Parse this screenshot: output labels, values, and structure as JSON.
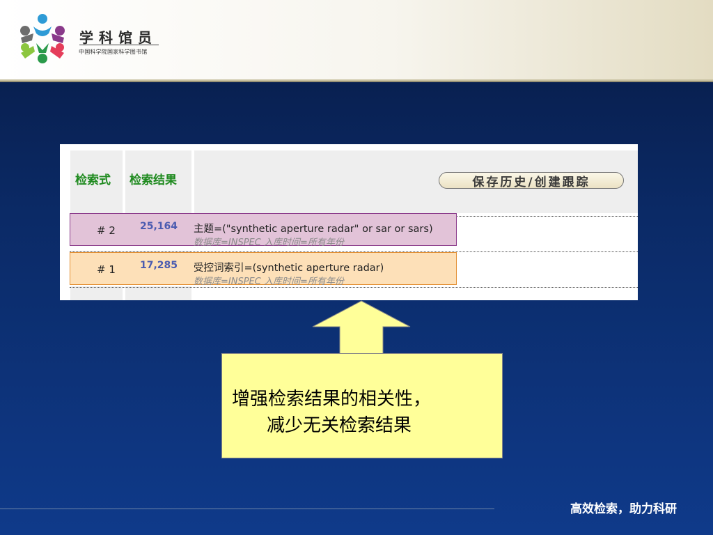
{
  "header": {
    "brand_title": "学科馆员",
    "brand_subtitle": "中国科学院国家科学图书馆"
  },
  "results_panel": {
    "col_query_header": "检索式",
    "col_results_header": "检索结果",
    "save_button_label": "保存历史/创建跟踪",
    "rows": [
      {
        "number": "# 2",
        "count": "25,164",
        "query": "主题=(\"synthetic aperture radar\" or sar or sars)",
        "meta": "数据库=INSPEC 入库时间=所有年份",
        "highlight": "#e2c3d8",
        "border": "#8a3a8a"
      },
      {
        "number": "# 1",
        "count": "17,285",
        "query": "受控词索引=(synthetic aperture radar)",
        "meta": "数据库=INSPEC 入库时间=所有年份",
        "highlight": "#fde0b8",
        "border": "#e38f32"
      }
    ]
  },
  "callout": {
    "line1": "增强检索结果的相关性，",
    "line2": "减少无关检索结果",
    "background": "#ffff99"
  },
  "footer": {
    "slogan": "高效检索，助力科研"
  }
}
